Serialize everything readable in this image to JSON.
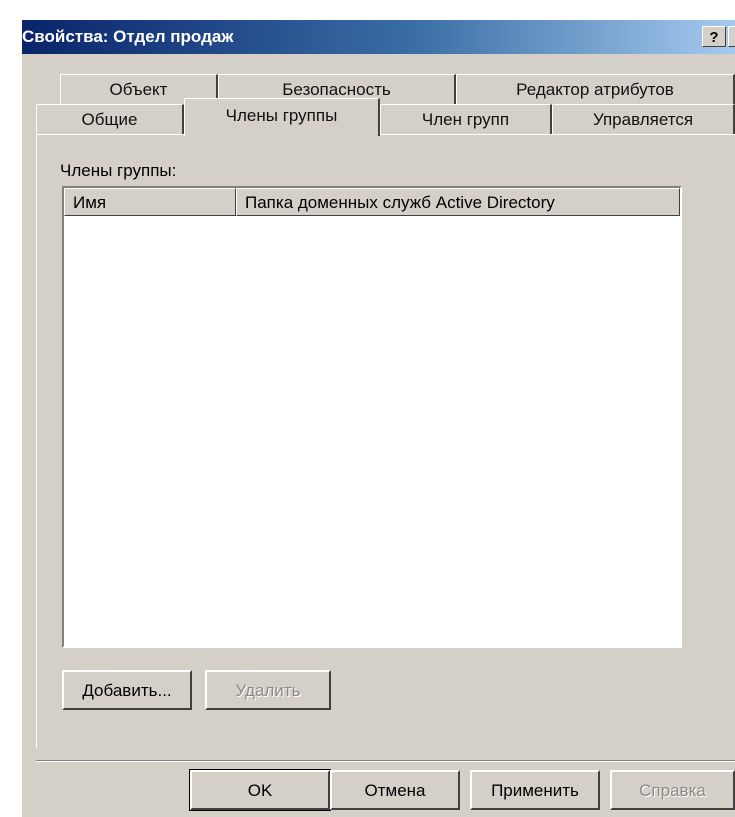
{
  "window": {
    "title": "Свойства: Отдел продаж",
    "help_button": "?",
    "close_button": "×"
  },
  "tabs_row1": [
    {
      "label": "Объект"
    },
    {
      "label": "Безопасность"
    },
    {
      "label": "Редактор атрибутов"
    }
  ],
  "tabs_row2": [
    {
      "label": "Общие"
    },
    {
      "label": "Члены группы",
      "active": true
    },
    {
      "label": "Член групп"
    },
    {
      "label": "Управляется"
    }
  ],
  "members": {
    "label": "Члены группы:",
    "columns": [
      "Имя",
      "Папка доменных служб Active Directory"
    ],
    "rows": []
  },
  "buttons": {
    "add": "Добавить...",
    "remove": "Удалить"
  },
  "footer": {
    "ok": "OK",
    "cancel": "Отмена",
    "apply": "Применить",
    "help": "Справка"
  },
  "colors": {
    "title_start": "#0a246a",
    "title_end": "#a6caf0",
    "face": "#d4d0c8"
  }
}
